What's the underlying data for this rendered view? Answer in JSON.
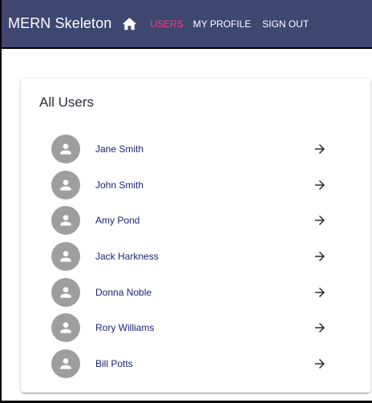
{
  "appbar": {
    "title": "MERN Skeleton",
    "background_color": "#3f4771",
    "home_icon": "home-icon",
    "nav": [
      {
        "label": "USERS",
        "active": true,
        "color": "#ff4081"
      },
      {
        "label": "MY PROFILE",
        "active": false,
        "color": "#ffffff"
      },
      {
        "label": "SIGN OUT",
        "active": false,
        "color": "#ffffff"
      }
    ]
  },
  "main": {
    "card_title": "All Users",
    "users": [
      {
        "name": "Jane Smith",
        "avatar_icon": "person-icon",
        "action_icon": "arrow-forward-icon"
      },
      {
        "name": "John Smith",
        "avatar_icon": "person-icon",
        "action_icon": "arrow-forward-icon"
      },
      {
        "name": "Amy Pond",
        "avatar_icon": "person-icon",
        "action_icon": "arrow-forward-icon"
      },
      {
        "name": "Jack Harkness",
        "avatar_icon": "person-icon",
        "action_icon": "arrow-forward-icon"
      },
      {
        "name": "Donna Noble",
        "avatar_icon": "person-icon",
        "action_icon": "arrow-forward-icon"
      },
      {
        "name": "Rory Williams",
        "avatar_icon": "person-icon",
        "action_icon": "arrow-forward-icon"
      },
      {
        "name": "Bill Potts",
        "avatar_icon": "person-icon",
        "action_icon": "arrow-forward-icon"
      }
    ],
    "avatar_color": "#9e9e9e",
    "name_color": "#1a237e"
  }
}
